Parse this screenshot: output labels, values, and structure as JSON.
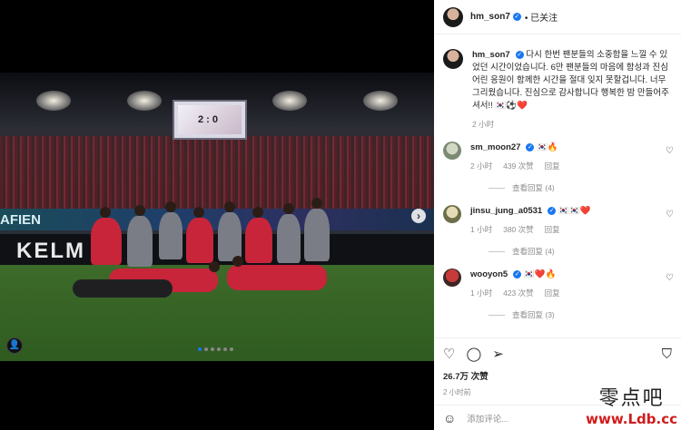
{
  "post": {
    "author": "hm_son7",
    "follow_status": "• 已关注",
    "caption": "다시 한번 팬분들의 소중함을 느낄 수 있었던 시간이었습니다. 6만 팬분들의 마음에 함성과 진심어린 응원이 함께한 시간을 절대 잊지 못할겁니다. 너무 그리웠습니다. 진심으로 감사합니다 행복한 밤 만들어주셔서!! 🇰🇷⚽❤️",
    "caption_time": "2 小时",
    "likes": "26.7万 次赞",
    "posted_time": "2 小时前",
    "comment_placeholder": "添加评论...",
    "image": {
      "ad_text": "KELM",
      "ad_text2": "AFIEN",
      "scoreboard": "2 : 0",
      "carousel_arrow": "›",
      "dots": 6
    }
  },
  "comments": [
    {
      "user": "sm_moon27",
      "text": "🇰🇷🔥",
      "time": "2 小时",
      "likes": "439 次赞",
      "reply": "回复",
      "view_replies": "查看回复 (4)"
    },
    {
      "user": "jinsu_jung_a0531",
      "text": "🇰🇷🇰🇷❤️",
      "time": "1 小时",
      "likes": "380 次赞",
      "reply": "回复",
      "view_replies": "查看回复 (4)"
    },
    {
      "user": "wooyon5",
      "text": "🇰🇷❤️🔥",
      "time": "1 小时",
      "likes": "423 次赞",
      "reply": "回复",
      "view_replies": "查看回复 (3)"
    }
  ],
  "watermark": {
    "cn": "零点吧",
    "url": "www.Ldb.cc"
  },
  "icons": [
    "heart-icon",
    "comment-icon",
    "share-icon",
    "bookmark-icon",
    "emoji-icon",
    "user-tag-icon",
    "verified-icon"
  ],
  "colors": {
    "verified": "#1877f2",
    "watermark_url": "#d01c1c"
  }
}
